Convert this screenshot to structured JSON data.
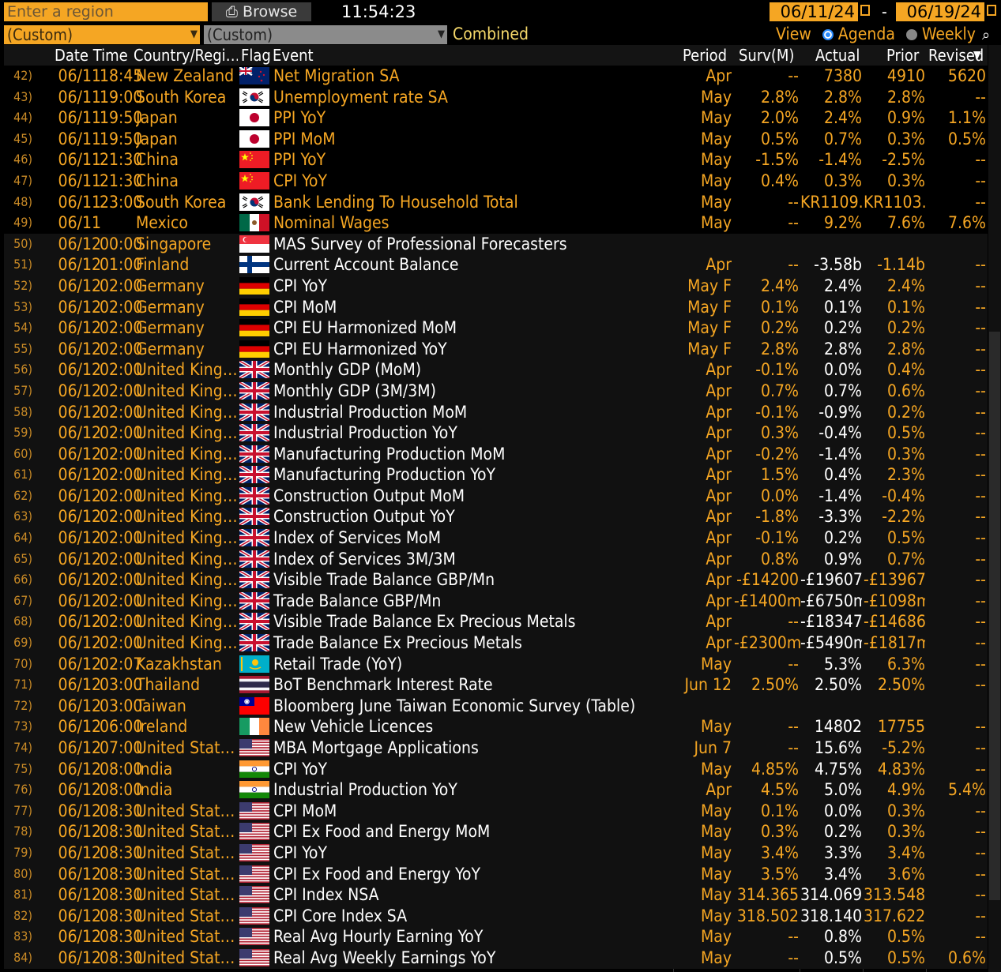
{
  "toolbar": {
    "region_placeholder": "Enter a region",
    "browse_label": "Browse",
    "clock": "11:54:23",
    "start_date": "06/11/24",
    "end_date": "06/19/24",
    "dash": "-",
    "filter1": "(Custom)",
    "filter2": "(Custom)",
    "combined_label": "Combined",
    "view_label": "View",
    "agenda_label": "Agenda",
    "weekly_label": "Weekly"
  },
  "columns": {
    "date_time": "Date Time",
    "country": "Country/Regi…",
    "flag": "Flag",
    "event": "Event",
    "period": "Period",
    "surv": "Surv(M)",
    "actual": "Actual",
    "prior": "Prior",
    "revised": "Revised"
  },
  "colors": {
    "accent": "#f5a623",
    "background": "#000000",
    "header_bg": "#141414",
    "white_text": "#ffffff"
  },
  "rows": [
    {
      "num": "42)",
      "date": "06/11",
      "time": "18:45",
      "country": "New Zealand",
      "flag": "nz",
      "event": "Net Migration SA",
      "period": "Apr",
      "surv": "--",
      "actual": "7380",
      "prior": "4910",
      "revised": "5620",
      "hl": true
    },
    {
      "num": "43)",
      "date": "06/11",
      "time": "19:00",
      "country": "South Korea",
      "flag": "kr",
      "event": "Unemployment rate SA",
      "period": "May",
      "surv": "2.8%",
      "actual": "2.8%",
      "prior": "2.8%",
      "revised": "--",
      "hl": true
    },
    {
      "num": "44)",
      "date": "06/11",
      "time": "19:50",
      "country": "Japan",
      "flag": "jp",
      "event": "PPI YoY",
      "period": "May",
      "surv": "2.0%",
      "actual": "2.4%",
      "prior": "0.9%",
      "revised": "1.1%",
      "hl": true
    },
    {
      "num": "45)",
      "date": "06/11",
      "time": "19:50",
      "country": "Japan",
      "flag": "jp",
      "event": "PPI MoM",
      "period": "May",
      "surv": "0.5%",
      "actual": "0.7%",
      "prior": "0.3%",
      "revised": "0.5%",
      "hl": true
    },
    {
      "num": "46)",
      "date": "06/11",
      "time": "21:30",
      "country": "China",
      "flag": "cn",
      "event": "PPI YoY",
      "period": "May",
      "surv": "-1.5%",
      "actual": "-1.4%",
      "prior": "-2.5%",
      "revised": "--",
      "hl": true
    },
    {
      "num": "47)",
      "date": "06/11",
      "time": "21:30",
      "country": "China",
      "flag": "cn",
      "event": "CPI YoY",
      "period": "May",
      "surv": "0.4%",
      "actual": "0.3%",
      "prior": "0.3%",
      "revised": "--",
      "hl": true
    },
    {
      "num": "48)",
      "date": "06/11",
      "time": "23:00",
      "country": "South Korea",
      "flag": "kr",
      "event": "Bank Lending To Household Total",
      "period": "May",
      "surv": "--",
      "actual": "KR1109.",
      "prior": "KR1103.",
      "revised": "--",
      "hl": true
    },
    {
      "num": "49)",
      "date": "06/11",
      "time": "",
      "country": "Mexico",
      "flag": "mx",
      "event": "Nominal Wages",
      "period": "May",
      "surv": "--",
      "actual": "9.2%",
      "prior": "7.6%",
      "revised": "7.6%",
      "hl": true
    },
    {
      "num": "50)",
      "date": "06/12",
      "time": "00:00",
      "country": "Singapore",
      "flag": "sg",
      "event": "MAS Survey of Professional Forecasters",
      "period": "",
      "surv": "",
      "actual": "",
      "prior": "",
      "revised": "",
      "hl": false
    },
    {
      "num": "51)",
      "date": "06/12",
      "time": "01:00",
      "country": "Finland",
      "flag": "fi",
      "event": "Current Account Balance",
      "period": "Apr",
      "surv": "--",
      "actual": "-3.58b",
      "prior": "-1.14b",
      "revised": "--",
      "hl": false
    },
    {
      "num": "52)",
      "date": "06/12",
      "time": "02:00",
      "country": "Germany",
      "flag": "de",
      "event": "CPI YoY",
      "period": "May F",
      "surv": "2.4%",
      "actual": "2.4%",
      "prior": "2.4%",
      "revised": "--",
      "hl": false
    },
    {
      "num": "53)",
      "date": "06/12",
      "time": "02:00",
      "country": "Germany",
      "flag": "de",
      "event": "CPI MoM",
      "period": "May F",
      "surv": "0.1%",
      "actual": "0.1%",
      "prior": "0.1%",
      "revised": "--",
      "hl": false
    },
    {
      "num": "54)",
      "date": "06/12",
      "time": "02:00",
      "country": "Germany",
      "flag": "de",
      "event": "CPI EU Harmonized MoM",
      "period": "May F",
      "surv": "0.2%",
      "actual": "0.2%",
      "prior": "0.2%",
      "revised": "--",
      "hl": false
    },
    {
      "num": "55)",
      "date": "06/12",
      "time": "02:00",
      "country": "Germany",
      "flag": "de",
      "event": "CPI EU Harmonized YoY",
      "period": "May F",
      "surv": "2.8%",
      "actual": "2.8%",
      "prior": "2.8%",
      "revised": "--",
      "hl": false
    },
    {
      "num": "56)",
      "date": "06/12",
      "time": "02:00",
      "country": "United King…",
      "flag": "gb",
      "event": "Monthly GDP (MoM)",
      "period": "Apr",
      "surv": "-0.1%",
      "actual": "0.0%",
      "prior": "0.4%",
      "revised": "--",
      "hl": false
    },
    {
      "num": "57)",
      "date": "06/12",
      "time": "02:00",
      "country": "United King…",
      "flag": "gb",
      "event": "Monthly GDP (3M/3M)",
      "period": "Apr",
      "surv": "0.7%",
      "actual": "0.7%",
      "prior": "0.6%",
      "revised": "--",
      "hl": false
    },
    {
      "num": "58)",
      "date": "06/12",
      "time": "02:00",
      "country": "United King…",
      "flag": "gb",
      "event": "Industrial Production MoM",
      "period": "Apr",
      "surv": "-0.1%",
      "actual": "-0.9%",
      "prior": "0.2%",
      "revised": "--",
      "hl": false
    },
    {
      "num": "59)",
      "date": "06/12",
      "time": "02:00",
      "country": "United King…",
      "flag": "gb",
      "event": "Industrial Production YoY",
      "period": "Apr",
      "surv": "0.3%",
      "actual": "-0.4%",
      "prior": "0.5%",
      "revised": "--",
      "hl": false
    },
    {
      "num": "60)",
      "date": "06/12",
      "time": "02:00",
      "country": "United King…",
      "flag": "gb",
      "event": "Manufacturing Production MoM",
      "period": "Apr",
      "surv": "-0.2%",
      "actual": "-1.4%",
      "prior": "0.3%",
      "revised": "--",
      "hl": false
    },
    {
      "num": "61)",
      "date": "06/12",
      "time": "02:00",
      "country": "United King…",
      "flag": "gb",
      "event": "Manufacturing Production YoY",
      "period": "Apr",
      "surv": "1.5%",
      "actual": "0.4%",
      "prior": "2.3%",
      "revised": "--",
      "hl": false
    },
    {
      "num": "62)",
      "date": "06/12",
      "time": "02:00",
      "country": "United King…",
      "flag": "gb",
      "event": "Construction Output MoM",
      "period": "Apr",
      "surv": "0.0%",
      "actual": "-1.4%",
      "prior": "-0.4%",
      "revised": "--",
      "hl": false
    },
    {
      "num": "63)",
      "date": "06/12",
      "time": "02:00",
      "country": "United King…",
      "flag": "gb",
      "event": "Construction Output YoY",
      "period": "Apr",
      "surv": "-1.8%",
      "actual": "-3.3%",
      "prior": "-2.2%",
      "revised": "--",
      "hl": false
    },
    {
      "num": "64)",
      "date": "06/12",
      "time": "02:00",
      "country": "United King…",
      "flag": "gb",
      "event": "Index of Services MoM",
      "period": "Apr",
      "surv": "-0.1%",
      "actual": "0.2%",
      "prior": "0.5%",
      "revised": "--",
      "hl": false
    },
    {
      "num": "65)",
      "date": "06/12",
      "time": "02:00",
      "country": "United King…",
      "flag": "gb",
      "event": "Index of Services 3M/3M",
      "period": "Apr",
      "surv": "0.8%",
      "actual": "0.9%",
      "prior": "0.7%",
      "revised": "--",
      "hl": false
    },
    {
      "num": "66)",
      "date": "06/12",
      "time": "02:00",
      "country": "United King…",
      "flag": "gb",
      "event": "Visible Trade Balance GBP/Mn",
      "period": "Apr",
      "surv": "-£14200",
      "actual": "-£19607",
      "prior": "-£13967",
      "revised": "--",
      "hl": false
    },
    {
      "num": "67)",
      "date": "06/12",
      "time": "02:00",
      "country": "United King…",
      "flag": "gb",
      "event": "Trade Balance GBP/Mn",
      "period": "Apr",
      "surv": "-£1400m",
      "actual": "-£6750m",
      "prior": "-£1098m",
      "revised": "--",
      "hl": false
    },
    {
      "num": "68)",
      "date": "06/12",
      "time": "02:00",
      "country": "United King…",
      "flag": "gb",
      "event": "Visible Trade Balance Ex Precious Metals",
      "period": "Apr",
      "surv": "--",
      "actual": "-£18347",
      "prior": "-£14686",
      "revised": "--",
      "hl": false
    },
    {
      "num": "69)",
      "date": "06/12",
      "time": "02:00",
      "country": "United King…",
      "flag": "gb",
      "event": "Trade Balance Ex Precious Metals",
      "period": "Apr",
      "surv": "-£2300m",
      "actual": "-£5490m",
      "prior": "-£1817m",
      "revised": "--",
      "hl": false
    },
    {
      "num": "70)",
      "date": "06/12",
      "time": "02:07",
      "country": "Kazakhstan",
      "flag": "kz",
      "event": "Retail Trade (YoY)",
      "period": "May",
      "surv": "--",
      "actual": "5.3%",
      "prior": "6.3%",
      "revised": "--",
      "hl": false
    },
    {
      "num": "71)",
      "date": "06/12",
      "time": "03:00",
      "country": "Thailand",
      "flag": "th",
      "event": "BoT Benchmark Interest Rate",
      "period": "Jun 12",
      "surv": "2.50%",
      "actual": "2.50%",
      "prior": "2.50%",
      "revised": "--",
      "hl": false
    },
    {
      "num": "72)",
      "date": "06/12",
      "time": "03:00",
      "country": "Taiwan",
      "flag": "tw",
      "event": "Bloomberg June Taiwan Economic Survey (Table)",
      "period": "",
      "surv": "",
      "actual": "",
      "prior": "",
      "revised": "",
      "hl": false
    },
    {
      "num": "73)",
      "date": "06/12",
      "time": "06:00",
      "country": "Ireland",
      "flag": "ie",
      "event": "New Vehicle Licences",
      "period": "May",
      "surv": "--",
      "actual": "14802",
      "prior": "17755",
      "revised": "--",
      "hl": false
    },
    {
      "num": "74)",
      "date": "06/12",
      "time": "07:00",
      "country": "United Stat…",
      "flag": "us",
      "event": "MBA Mortgage Applications",
      "period": "Jun 7",
      "surv": "--",
      "actual": "15.6%",
      "prior": "-5.2%",
      "revised": "--",
      "hl": false
    },
    {
      "num": "75)",
      "date": "06/12",
      "time": "08:00",
      "country": "India",
      "flag": "in",
      "event": "CPI YoY",
      "period": "May",
      "surv": "4.85%",
      "actual": "4.75%",
      "prior": "4.83%",
      "revised": "--",
      "hl": false
    },
    {
      "num": "76)",
      "date": "06/12",
      "time": "08:00",
      "country": "India",
      "flag": "in",
      "event": "Industrial Production YoY",
      "period": "Apr",
      "surv": "4.5%",
      "actual": "5.0%",
      "prior": "4.9%",
      "revised": "5.4%",
      "hl": false
    },
    {
      "num": "77)",
      "date": "06/12",
      "time": "08:30",
      "country": "United Stat…",
      "flag": "us",
      "event": "CPI MoM",
      "period": "May",
      "surv": "0.1%",
      "actual": "0.0%",
      "prior": "0.3%",
      "revised": "--",
      "hl": false
    },
    {
      "num": "78)",
      "date": "06/12",
      "time": "08:30",
      "country": "United Stat…",
      "flag": "us",
      "event": "CPI Ex Food and Energy MoM",
      "period": "May",
      "surv": "0.3%",
      "actual": "0.2%",
      "prior": "0.3%",
      "revised": "--",
      "hl": false
    },
    {
      "num": "79)",
      "date": "06/12",
      "time": "08:30",
      "country": "United Stat…",
      "flag": "us",
      "event": "CPI YoY",
      "period": "May",
      "surv": "3.4%",
      "actual": "3.3%",
      "prior": "3.4%",
      "revised": "--",
      "hl": false
    },
    {
      "num": "80)",
      "date": "06/12",
      "time": "08:30",
      "country": "United Stat…",
      "flag": "us",
      "event": "CPI Ex Food and Energy YoY",
      "period": "May",
      "surv": "3.5%",
      "actual": "3.4%",
      "prior": "3.6%",
      "revised": "--",
      "hl": false
    },
    {
      "num": "81)",
      "date": "06/12",
      "time": "08:30",
      "country": "United Stat…",
      "flag": "us",
      "event": "CPI Index NSA",
      "period": "May",
      "surv": "314.365",
      "actual": "314.069",
      "prior": "313.548",
      "revised": "--",
      "hl": false
    },
    {
      "num": "82)",
      "date": "06/12",
      "time": "08:30",
      "country": "United Stat…",
      "flag": "us",
      "event": "CPI Core Index SA",
      "period": "May",
      "surv": "318.502",
      "actual": "318.140",
      "prior": "317.622",
      "revised": "--",
      "hl": false
    },
    {
      "num": "83)",
      "date": "06/12",
      "time": "08:30",
      "country": "United Stat…",
      "flag": "us",
      "event": "Real Avg Hourly Earning YoY",
      "period": "May",
      "surv": "--",
      "actual": "0.8%",
      "prior": "0.5%",
      "revised": "--",
      "hl": false
    },
    {
      "num": "84)",
      "date": "06/12",
      "time": "08:30",
      "country": "United Stat…",
      "flag": "us",
      "event": "Real Avg Weekly Earnings YoY",
      "period": "May",
      "surv": "--",
      "actual": "0.5%",
      "prior": "0.5%",
      "revised": "0.6%",
      "hl": false
    }
  ]
}
